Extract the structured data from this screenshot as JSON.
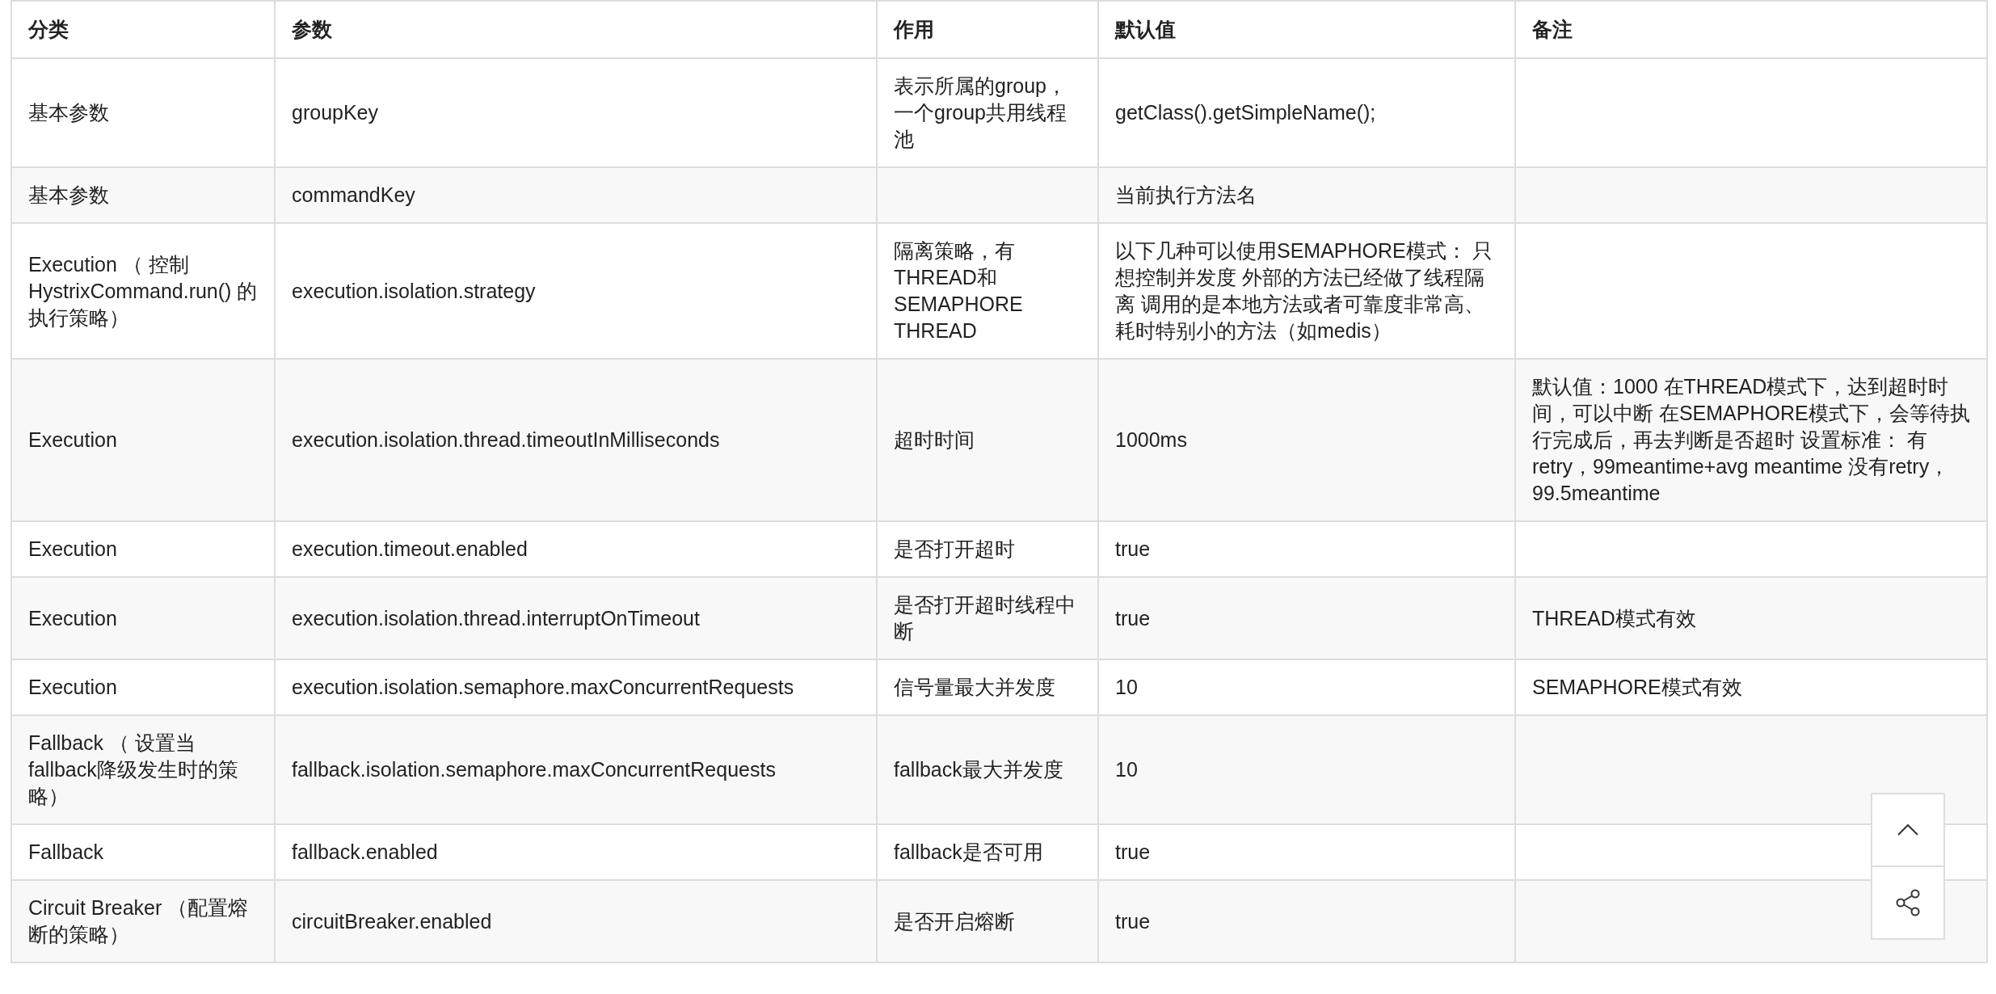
{
  "table": {
    "columns": [
      "分类",
      "参数",
      "作用",
      "默认值",
      "备注"
    ],
    "rows": [
      {
        "cells": [
          "基本参数",
          "groupKey",
          "表示所属的group，一个group共用线程池",
          "getClass().getSimpleName();",
          ""
        ]
      },
      {
        "cells": [
          "基本参数",
          "commandKey",
          "",
          "当前执行方法名",
          ""
        ]
      },
      {
        "cells": [
          "Execution （ 控制HystrixCommand.run() 的执行策略）",
          "execution.isolation.strategy",
          "隔离策略，有THREAD和 SEMAPHORE THREAD",
          "以下几种可以使用SEMAPHORE模式： 只想控制并发度 外部的方法已经做了线程隔离 调用的是本地方法或者可靠度非常高、耗时特别小的方法（如medis）",
          ""
        ]
      },
      {
        "cells": [
          "Execution",
          "execution.isolation.thread.timeoutInMilliseconds",
          "超时时间",
          "1000ms",
          "默认值：1000 在THREAD模式下，达到超时时间，可以中断 在SEMAPHORE模式下，会等待执行完成后，再去判断是否超时 设置标准： 有retry，99meantime+avg meantime 没有retry，99.5meantime"
        ]
      },
      {
        "cells": [
          "Execution",
          "execution.timeout.enabled",
          "是否打开超时",
          "true",
          ""
        ]
      },
      {
        "cells": [
          "Execution",
          "execution.isolation.thread.interruptOnTimeout",
          "是否打开超时线程中断",
          "true",
          "THREAD模式有效"
        ]
      },
      {
        "cells": [
          "Execution",
          "execution.isolation.semaphore.maxConcurrentRequests",
          "信号量最大并发度",
          "10",
          "SEMAPHORE模式有效"
        ]
      },
      {
        "cells": [
          "Fallback （ 设置当fallback降级发生时的策略）",
          "fallback.isolation.semaphore.maxConcurrentRequests",
          "fallback最大并发度",
          "10",
          ""
        ]
      },
      {
        "cells": [
          "Fallback",
          "fallback.enabled",
          "fallback是否可用",
          "true",
          ""
        ]
      },
      {
        "cells": [
          "Circuit Breaker （配置熔断的策略）",
          "circuitBreaker.enabled",
          "是否开启熔断",
          "true",
          ""
        ]
      }
    ]
  }
}
